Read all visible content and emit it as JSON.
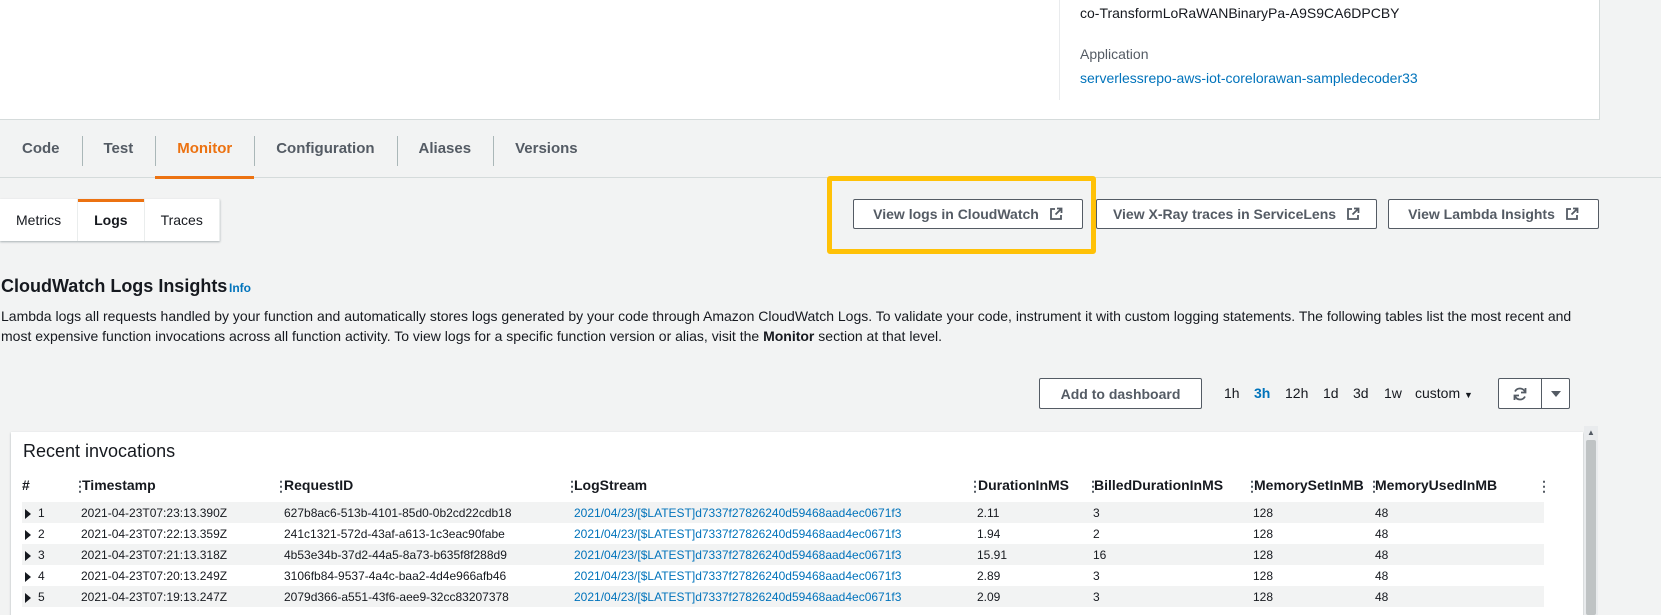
{
  "details": {
    "function_name": "co-TransformLoRaWANBinaryPa-A9S9CA6DPCBY",
    "application_label": "Application",
    "application_link": "serverlessrepo-aws-iot-corelorawan-sampledecoder33"
  },
  "main_tabs": [
    "Code",
    "Test",
    "Monitor",
    "Configuration",
    "Aliases",
    "Versions"
  ],
  "main_tabs_active": "Monitor",
  "sub_tabs": [
    "Metrics",
    "Logs",
    "Traces"
  ],
  "sub_tabs_active": "Logs",
  "actions": {
    "cloudwatch": "View logs in CloudWatch",
    "xray": "View X-Ray traces in ServiceLens",
    "insights": "View Lambda Insights"
  },
  "insights": {
    "title": "CloudWatch Logs Insights",
    "info": "Info",
    "desc_part1": "Lambda logs all requests handled by your function and automatically stores logs generated by your code through Amazon CloudWatch Logs. To validate your code, instrument it with custom logging statements. The following tables list the most recent and most expensive function invocations across all function activity. To view logs for a specific function version or alias, visit the ",
    "desc_bold": "Monitor",
    "desc_part2": " section at that level."
  },
  "dashboard": {
    "add_button": "Add to dashboard",
    "ranges": [
      "1h",
      "3h",
      "12h",
      "1d",
      "3d",
      "1w"
    ],
    "active_range": "3h",
    "custom": "custom"
  },
  "invocations": {
    "title": "Recent invocations",
    "columns": [
      "#",
      "Timestamp",
      "RequestID",
      "LogStream",
      "DurationInMS",
      "BilledDurationInMS",
      "MemorySetInMB",
      "MemoryUsedInMB"
    ],
    "rows": [
      [
        "1",
        "2021-04-23T07:23:13.390Z",
        "627b8ac6-513b-4101-85d0-0b2cd22cdb18",
        "2021/04/23/[$LATEST]d7337f27826240d59468aad4ec0671f3",
        "2.11",
        "3",
        "128",
        "48"
      ],
      [
        "2",
        "2021-04-23T07:22:13.359Z",
        "241c1321-572d-43af-a613-1c3eac90fabe",
        "2021/04/23/[$LATEST]d7337f27826240d59468aad4ec0671f3",
        "1.94",
        "2",
        "128",
        "48"
      ],
      [
        "3",
        "2021-04-23T07:21:13.318Z",
        "4b53e34b-37d2-44a5-8a73-b635f8f288d9",
        "2021/04/23/[$LATEST]d7337f27826240d59468aad4ec0671f3",
        "15.91",
        "16",
        "128",
        "48"
      ],
      [
        "4",
        "2021-04-23T07:20:13.249Z",
        "3106fb84-9537-4a4c-baa2-4d4e966afb46",
        "2021/04/23/[$LATEST]d7337f27826240d59468aad4ec0671f3",
        "2.89",
        "3",
        "128",
        "48"
      ],
      [
        "5",
        "2021-04-23T07:19:13.247Z",
        "2079d366-a551-43f6-aee9-32cc83207378",
        "2021/04/23/[$LATEST]d7337f27826240d59468aad4ec0671f3",
        "2.09",
        "3",
        "128",
        "48"
      ]
    ]
  },
  "colors": {
    "accent": "#ec7211",
    "link": "#0073bb",
    "highlight": "#ffc107"
  }
}
